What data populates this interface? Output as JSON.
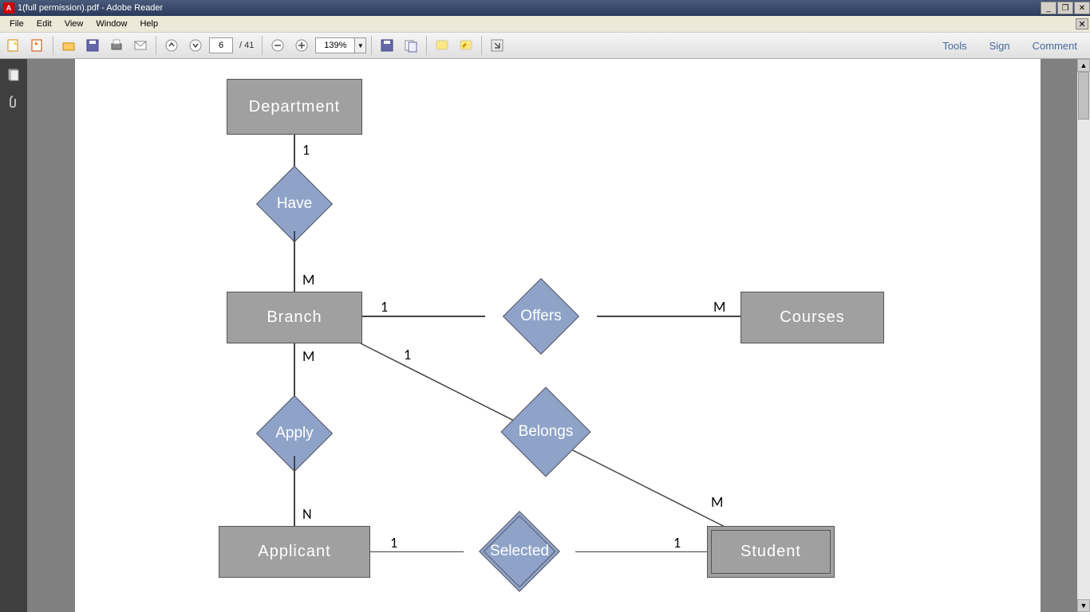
{
  "window": {
    "title": "1(full permission).pdf - Adobe Reader",
    "app_icon_letter": "A"
  },
  "menu": {
    "items": [
      "File",
      "Edit",
      "View",
      "Window",
      "Help"
    ]
  },
  "toolbar": {
    "page_current": "6",
    "page_prefix": "/",
    "page_total": "41",
    "zoom": "139%",
    "links": {
      "tools": "Tools",
      "sign": "Sign",
      "comment": "Comment"
    }
  },
  "diagram": {
    "entities": {
      "department": "Department",
      "branch": "Branch",
      "courses": "Courses",
      "applicant": "Applicant",
      "student": "Student"
    },
    "relationships": {
      "have": "Have",
      "offers": "Offers",
      "apply": "Apply",
      "belongs": "Belongs",
      "selected": "Selected"
    },
    "cardinalities": {
      "dept_have": "1",
      "have_branch": "M",
      "branch_offers": "1",
      "offers_courses": "M",
      "branch_apply": "M",
      "apply_applicant": "N",
      "branch_belongs": "1",
      "belongs_student": "M",
      "applicant_selected": "1",
      "selected_student": "1"
    }
  }
}
